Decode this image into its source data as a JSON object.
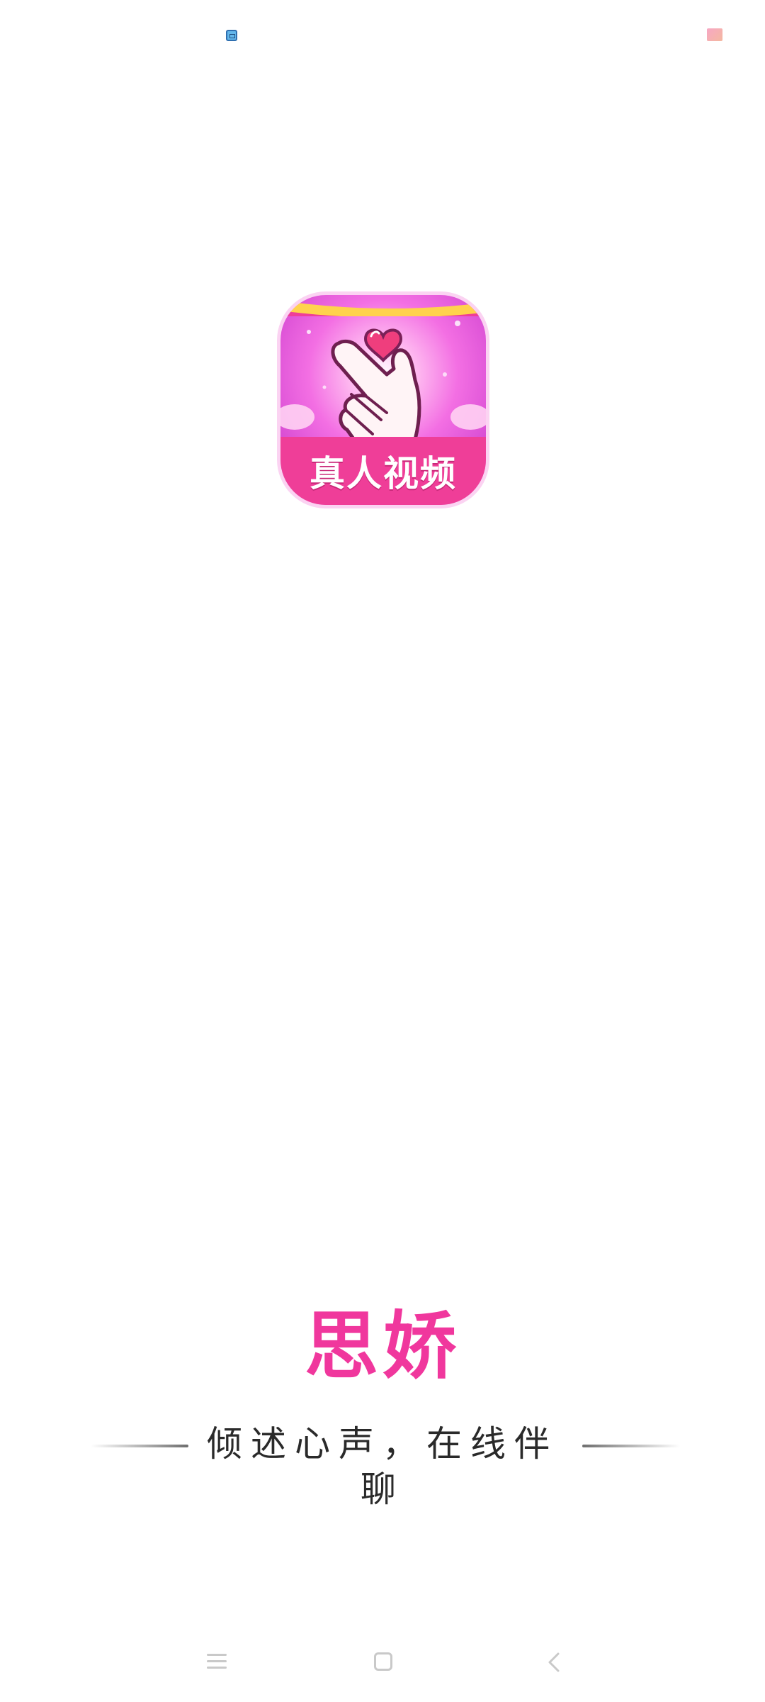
{
  "status_bar": {
    "left_icon": "app-notification-icon",
    "right_icon": "battery-icon"
  },
  "logo": {
    "badge_text": "真人视频",
    "icon": "finger-heart-icon"
  },
  "app_name": "思娇",
  "slogan": "倾述心声，在线伴聊",
  "nav_bar": {
    "menu_icon": "menu-icon",
    "home_icon": "home-icon",
    "back_icon": "back-icon"
  },
  "colors": {
    "brand_pink": "#f0379d",
    "band_pink": "#ef3e98",
    "text_dark": "#2a2a2a"
  }
}
